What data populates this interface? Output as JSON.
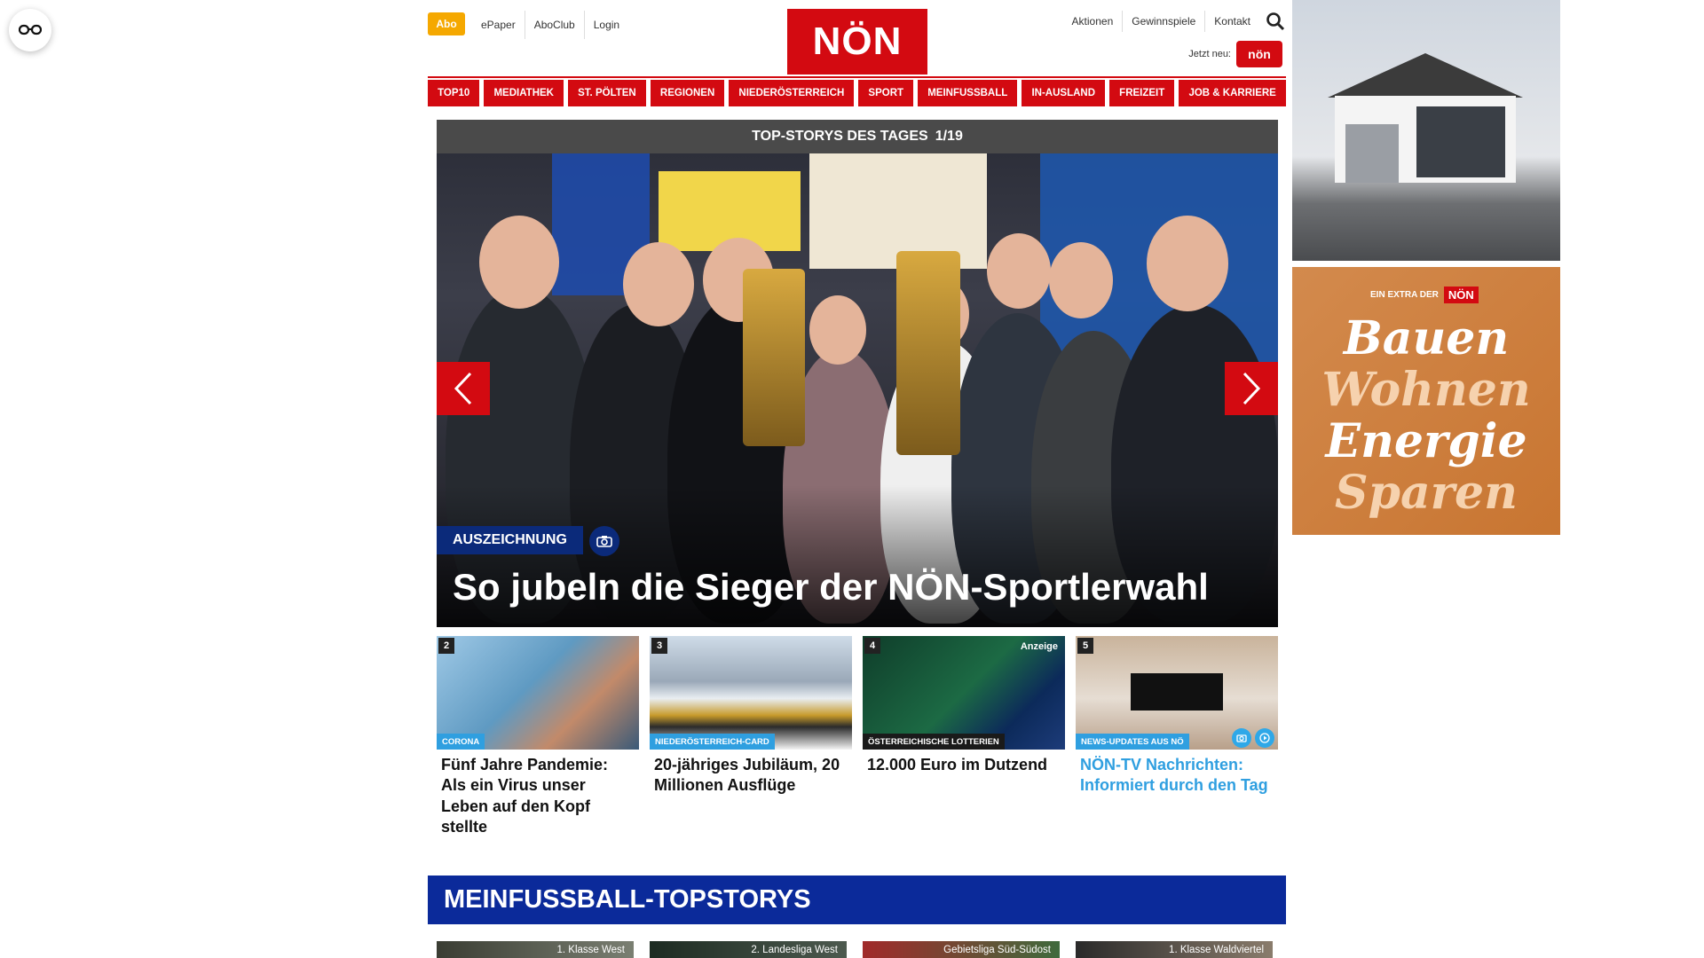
{
  "accessibility": {
    "label": "",
    "icon": "glasses-icon"
  },
  "header": {
    "abo": "Abo",
    "links": [
      "ePaper",
      "AboClub",
      "Login"
    ],
    "logo": "NÖN",
    "right_links": [
      "Aktionen",
      "Gewinnspiele",
      "Kontakt"
    ],
    "jetzt_neu": "Jetzt neu:",
    "jetzt_badge": "nön"
  },
  "nav": [
    "TOP10",
    "MEDIATHEK",
    "ST. PÖLTEN",
    "REGIONEN",
    "NIEDERÖSTERREICH",
    "SPORT",
    "MEINFUSSBALL",
    "IN-AUSLAND",
    "FREIZEIT",
    "JOB & KARRIERE"
  ],
  "slider": {
    "heading": "TOP-STORYS DES TAGES",
    "position": "1/19",
    "tag": "AUSZEICHNUNG",
    "title": "So jubeln die Sieger der NÖN-Sportlerwahl"
  },
  "cards": [
    {
      "num": "2",
      "category": "CORONA",
      "category_color": "#2f9fe0",
      "headline": "Fünf Jahre Pandemie: Als ein Virus unser Leben auf den Kopf stellte",
      "ad": ""
    },
    {
      "num": "3",
      "category": "NIEDERÖSTERREICH-CARD",
      "category_color": "#2f9fe0",
      "headline": "20-jähriges Jubiläum, 20 Millionen Ausflüge",
      "ad": ""
    },
    {
      "num": "4",
      "category": "ÖSTERREICHISCHE LOTTERIEN",
      "category_color": "#1a1a1a",
      "headline": "12.000 Euro im Dutzend",
      "ad": "Anzeige"
    },
    {
      "num": "5",
      "category": "NEWS-UPDATES AUS NÖ",
      "category_color": "#2f9fe0",
      "headline": "NÖN-TV Nachrichten: Informiert durch den Tag",
      "ad": ""
    }
  ],
  "section": {
    "title": "MEINFUSSBALL-TOPSTORYS"
  },
  "thumbs": [
    "1. Klasse West",
    "2. Landesliga West",
    "Gebietsliga Süd-Südost",
    "1. Klasse Waldviertel"
  ],
  "ads": {
    "extra_label": "EIN EXTRA DER",
    "extra_logo": "NÖN",
    "words": [
      "Bauen",
      "Wohnen",
      "Energie",
      "Sparen"
    ],
    "word_colors": [
      "#ffffff",
      "#f6d2ae",
      "#ffffff",
      "#f6d2ae"
    ]
  },
  "colors": {
    "brand_red": "#d30a11",
    "abo_orange": "#f5a800",
    "tag_blue": "#0b2a7a",
    "section_blue": "#0b2a9a",
    "link_blue": "#2f9fe0"
  }
}
